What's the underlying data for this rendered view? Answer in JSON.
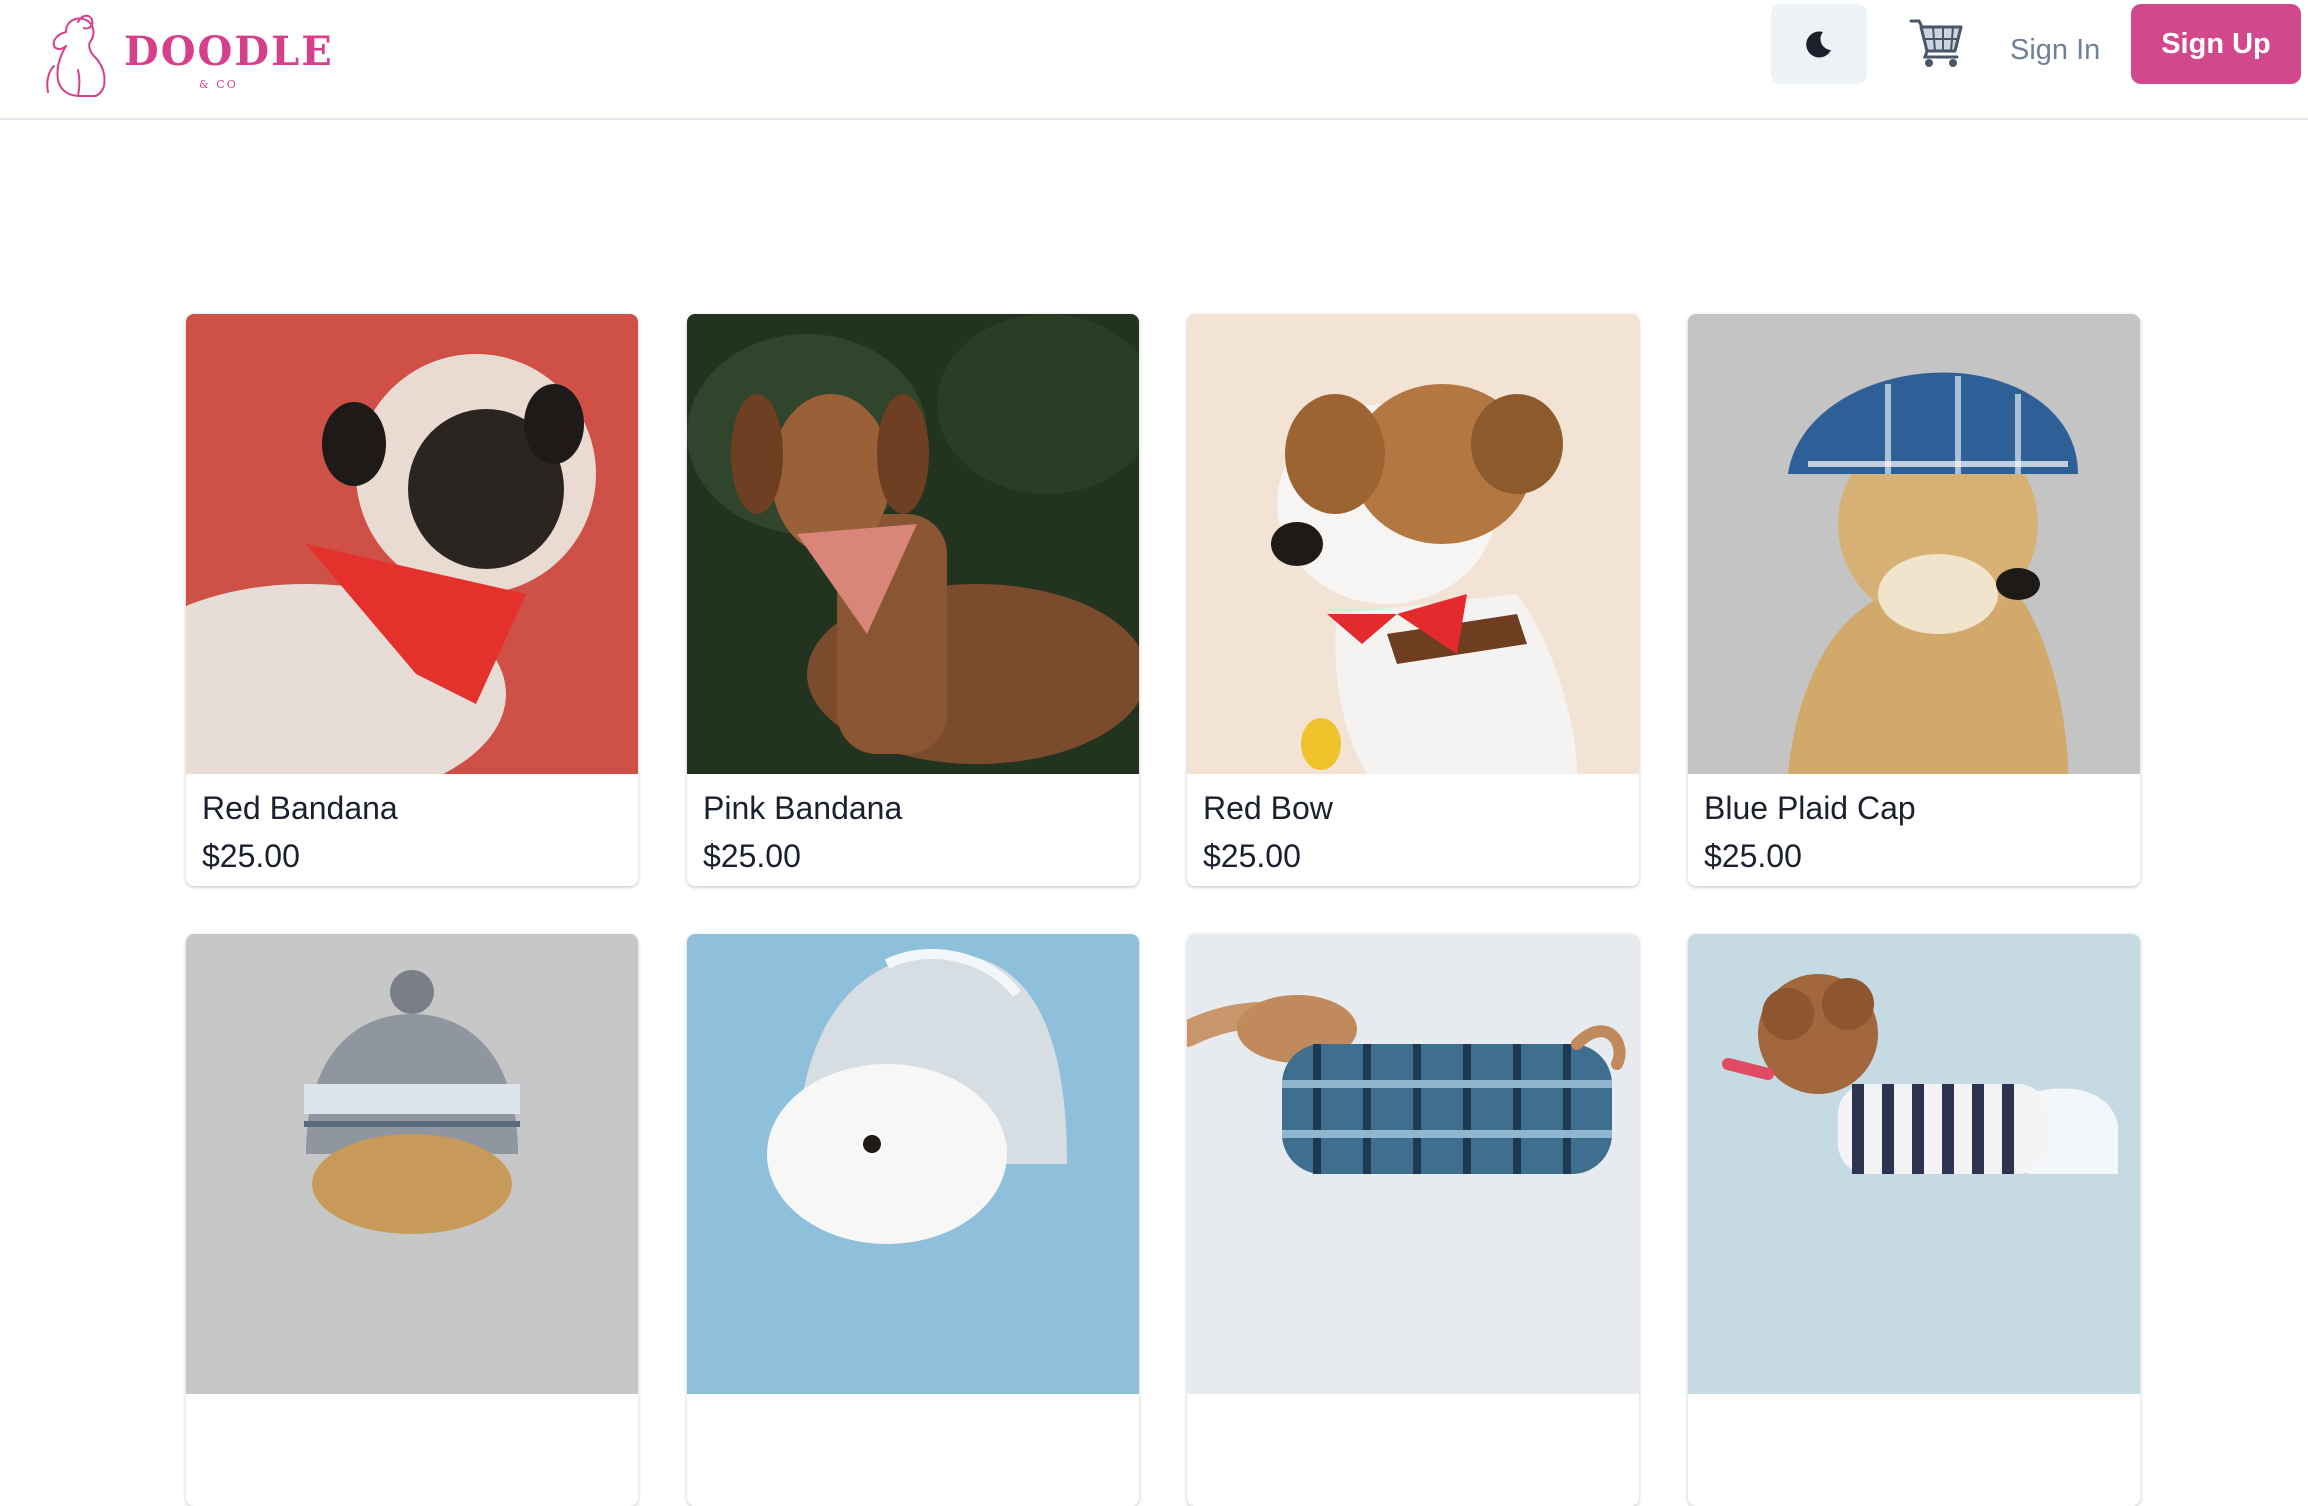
{
  "brand": {
    "name": "DOODLE",
    "sub": "& CO"
  },
  "nav": {
    "theme_icon": "moon-icon",
    "cart_icon": "cart-icon",
    "sign_in": "Sign In",
    "sign_up": "Sign Up"
  },
  "colors": {
    "brand": "#d53f8c",
    "button": "#d1498c",
    "muted": "#718096"
  },
  "products": [
    {
      "name": "Red Bandana",
      "price": "$25.00",
      "bg": "#cf5046"
    },
    {
      "name": "Pink Bandana",
      "price": "$25.00",
      "bg": "#22331f"
    },
    {
      "name": "Red Bow",
      "price": "$25.00",
      "bg": "#f3e3d4"
    },
    {
      "name": "Blue Plaid Cap",
      "price": "$25.00",
      "bg": "#c4c4c4"
    },
    {
      "name": "",
      "price": "",
      "bg": "#c7c7c7"
    },
    {
      "name": "",
      "price": "",
      "bg": "#8fc0db"
    },
    {
      "name": "",
      "price": "",
      "bg": "#e7eaee"
    },
    {
      "name": "",
      "price": "",
      "bg": "#c5dae2"
    }
  ]
}
